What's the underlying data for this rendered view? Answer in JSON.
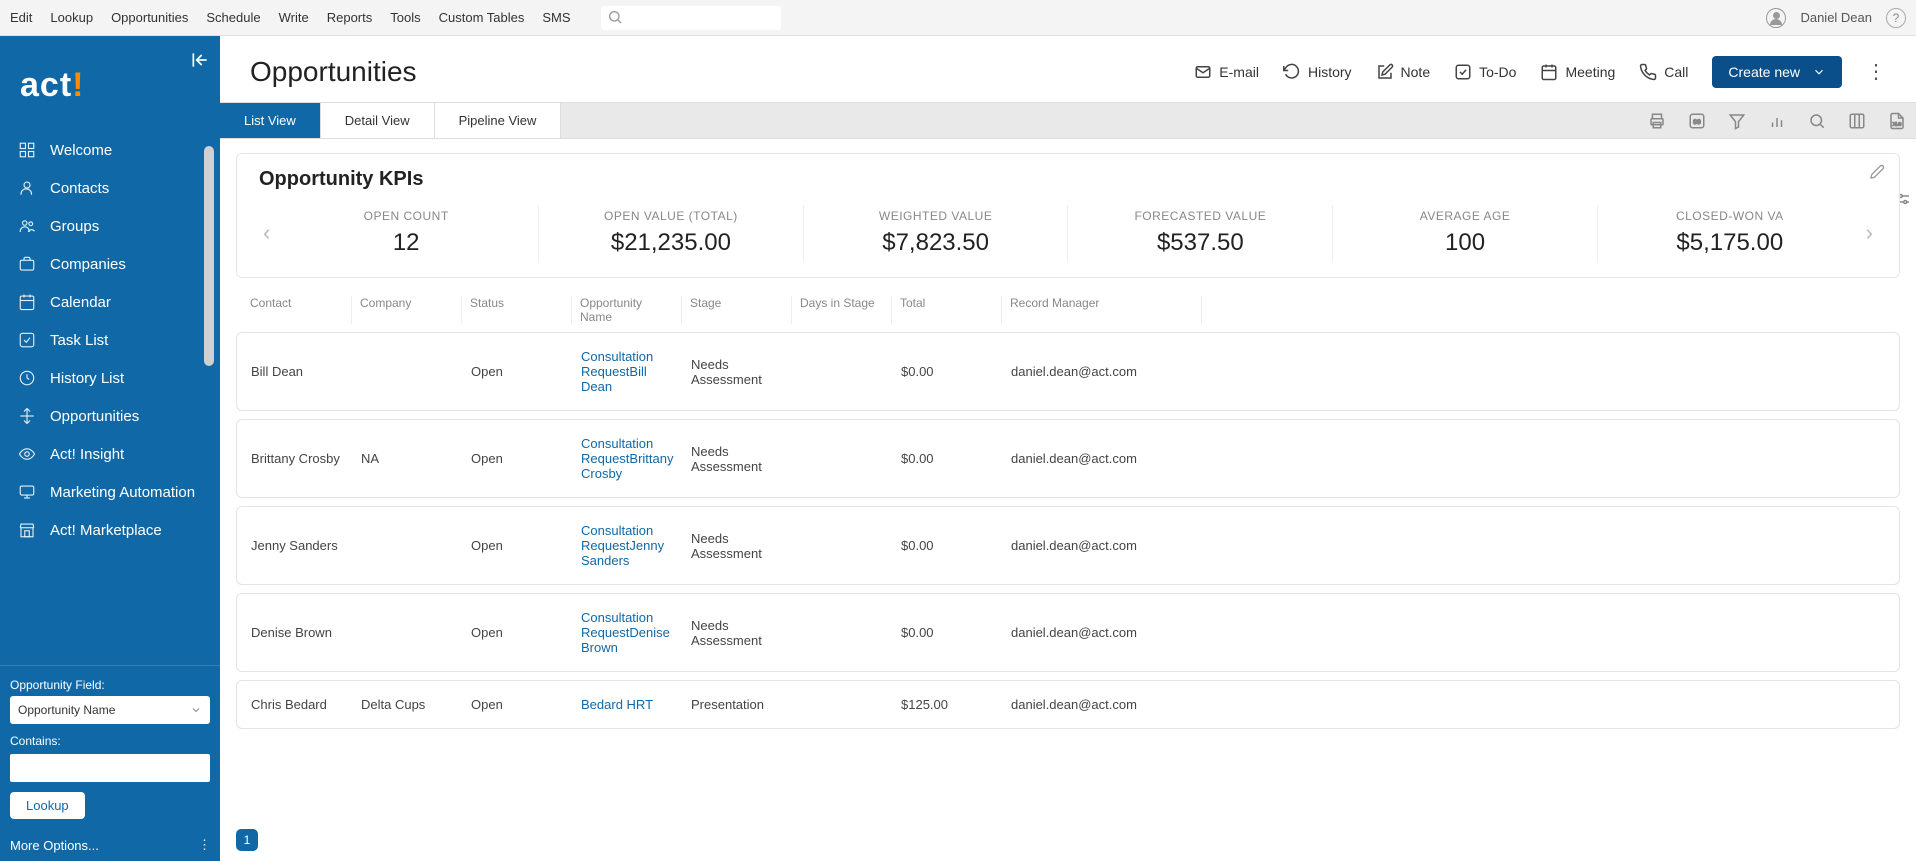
{
  "topmenu": [
    "Edit",
    "Lookup",
    "Opportunities",
    "Schedule",
    "Write",
    "Reports",
    "Tools",
    "Custom Tables",
    "SMS"
  ],
  "user": "Daniel Dean",
  "logo": {
    "text": "act",
    "ex": "!"
  },
  "nav": [
    {
      "label": "Welcome",
      "icon": "grid"
    },
    {
      "label": "Contacts",
      "icon": "user"
    },
    {
      "label": "Groups",
      "icon": "users"
    },
    {
      "label": "Companies",
      "icon": "briefcase"
    },
    {
      "label": "Calendar",
      "icon": "calendar"
    },
    {
      "label": "Task List",
      "icon": "check"
    },
    {
      "label": "History List",
      "icon": "history"
    },
    {
      "label": "Opportunities",
      "icon": "arrows"
    },
    {
      "label": "Act! Insight",
      "icon": "eye"
    },
    {
      "label": "Marketing Automation",
      "icon": "monitor"
    },
    {
      "label": "Act! Marketplace",
      "icon": "store"
    }
  ],
  "lookup": {
    "fieldLabel": "Opportunity Field:",
    "fieldValue": "Opportunity Name",
    "containsLabel": "Contains:",
    "containsValue": "",
    "button": "Lookup",
    "more": "More Options..."
  },
  "page": {
    "title": "Opportunities"
  },
  "actions": {
    "email": "E-mail",
    "history": "History",
    "note": "Note",
    "todo": "To-Do",
    "meeting": "Meeting",
    "call": "Call",
    "create": "Create new"
  },
  "tabs": [
    "List View",
    "Detail View",
    "Pipeline View"
  ],
  "activeTab": 0,
  "kpi": {
    "title": "Opportunity KPIs",
    "cells": [
      {
        "label": "OPEN COUNT",
        "value": "12"
      },
      {
        "label": "OPEN VALUE (TOTAL)",
        "value": "$21,235.00"
      },
      {
        "label": "WEIGHTED VALUE",
        "value": "$7,823.50"
      },
      {
        "label": "FORECASTED VALUE",
        "value": "$537.50"
      },
      {
        "label": "AVERAGE AGE",
        "value": "100"
      },
      {
        "label": "CLOSED-WON VA",
        "value": "$5,175.00"
      }
    ]
  },
  "columns": [
    "Contact",
    "Company",
    "Status",
    "Opportunity Name",
    "Stage",
    "Days in Stage",
    "Total",
    "Record Manager"
  ],
  "rows": [
    {
      "contact": "Bill Dean",
      "company": "",
      "status": "Open",
      "opp": "Consultation RequestBill Dean",
      "stage": "Needs Assessment",
      "days": "",
      "total": "$0.00",
      "mgr": "daniel.dean@act.com"
    },
    {
      "contact": "Brittany Crosby",
      "company": "NA",
      "status": "Open",
      "opp": "Consultation RequestBrittany Crosby",
      "stage": "Needs Assessment",
      "days": "",
      "total": "$0.00",
      "mgr": "daniel.dean@act.com"
    },
    {
      "contact": "Jenny Sanders",
      "company": "",
      "status": "Open",
      "opp": "Consultation RequestJenny Sanders",
      "stage": "Needs Assessment",
      "days": "",
      "total": "$0.00",
      "mgr": "daniel.dean@act.com"
    },
    {
      "contact": "Denise Brown",
      "company": "",
      "status": "Open",
      "opp": "Consultation RequestDenise Brown",
      "stage": "Needs Assessment",
      "days": "",
      "total": "$0.00",
      "mgr": "daniel.dean@act.com"
    },
    {
      "contact": "Chris Bedard",
      "company": "Delta Cups",
      "status": "Open",
      "opp": "Bedard HRT",
      "stage": "Presentation",
      "days": "",
      "total": "$125.00",
      "mgr": "daniel.dean@act.com"
    }
  ],
  "pager": {
    "current": "1"
  }
}
